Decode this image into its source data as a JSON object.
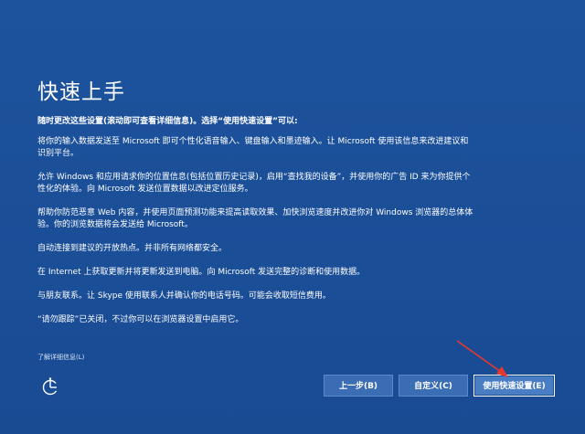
{
  "title": "快速上手",
  "intro": "随时更改这些设置(滚动即可查看详细信息)。选择“使用快速设置”可以:",
  "paragraphs": [
    "将你的输入数据发送至 Microsoft 即可个性化语音输入、键盘输入和墨迹输入。让 Microsoft 使用该信息来改进建议和识别平台。",
    "允许 Windows 和应用请求你的位置信息(包括位置历史记录)，启用“查找我的设备”，并使用你的广告 ID 来为你提供个性化的体验。向 Microsoft 发送位置数据以改进定位服务。",
    "帮助你防范恶意 Web 内容，并使用页面预测功能来提高读取效果、加快浏览速度并改进你对 Windows 浏览器的总体体验。你的浏览数据将会发送给 Microsoft。",
    "自动连接到建议的开放热点。并非所有网络都安全。",
    "在 Internet 上获取更新并将更新发送到电脑。向 Microsoft 发送完整的诊断和使用数据。",
    "与朋友联系。让 Skype 使用联系人并确认你的电话号码。可能会收取短信费用。",
    "“请勿跟踪”已关闭，不过你可以在浏览器设置中启用它。"
  ],
  "learn_more": "了解详细信息(L)",
  "buttons": {
    "back": "上一步(B)",
    "customize": "自定义(C)",
    "express": "使用快速设置(E)"
  },
  "icons": {
    "accessibility": "ease-of-access-icon"
  },
  "colors": {
    "background": "#1b4f98",
    "button": "#3a6db3",
    "annotation_arrow": "#e8372e"
  }
}
